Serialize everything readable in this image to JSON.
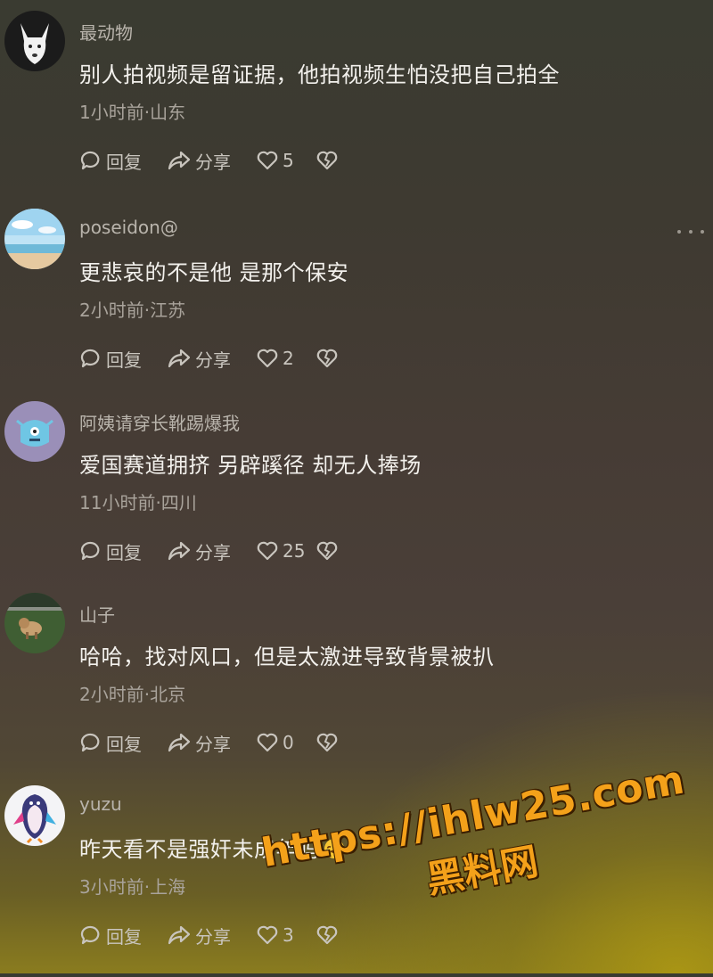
{
  "actions": {
    "reply_label": "回复",
    "share_label": "分享"
  },
  "comments": [
    {
      "username": "最动物",
      "text": "别人拍视频是留证据，他拍视频生怕没把自己拍全",
      "meta": "1小时前·山东",
      "likes": "5",
      "avatar_icon": "white-fox-avatar"
    },
    {
      "username": "poseidon@",
      "text": "更悲哀的不是他 是那个保安",
      "meta": "2小时前·江苏",
      "likes": "2",
      "avatar_icon": "beach-sky-avatar"
    },
    {
      "username": "阿姨请穿长靴踢爆我",
      "text": "爱国赛道拥挤 另辟蹊径 却无人捧场",
      "meta": "11小时前·四川",
      "likes": "25",
      "avatar_icon": "blue-monster-avatar"
    },
    {
      "username": "山子",
      "text": "哈哈，找对风口，但是太激进导致背景被扒",
      "meta": "2小时前·北京",
      "likes": "0",
      "avatar_icon": "dog-on-grass-avatar"
    },
    {
      "username": "yuzu",
      "text": "昨天看不是强奸未成年吗",
      "meta": "3小时前·上海",
      "likes": "3",
      "avatar_icon": "colorful-penguin-avatar",
      "emoji": "rofl-emoji"
    }
  ],
  "watermark": {
    "url": "https://ihlw25.com",
    "name": "黑料网"
  },
  "colors": {
    "watermark": "#f4a11a",
    "text": "#f2f0ec",
    "secondary": "#a9a39b"
  }
}
